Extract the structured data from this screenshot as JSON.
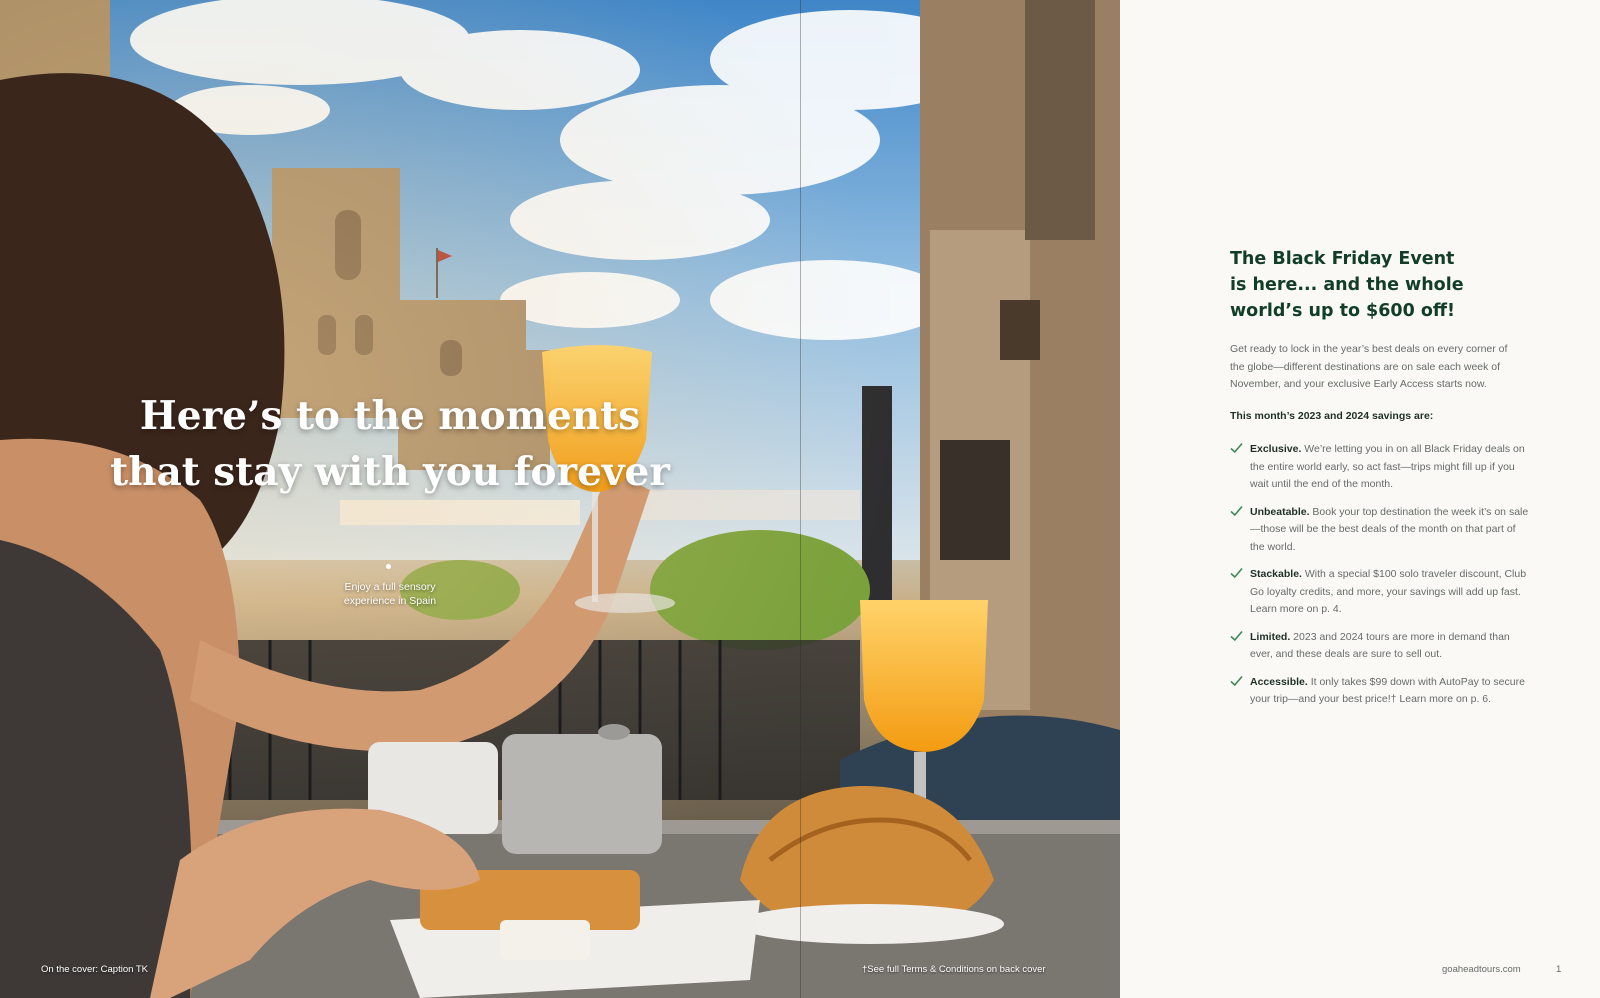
{
  "left_page": {
    "headline": "Here’s to the moments that stay with you forever",
    "photo_caption": "Enjoy a full sensory experience in Spain",
    "cover_caption": "On the cover:  Caption TK",
    "terms_note": "†See full Terms & Conditions on back cover"
  },
  "right_page": {
    "title": "The Black Friday Event is here... and the whole world’s up to $600 off!",
    "intro": "Get ready to lock in the year’s best deals on every corner of the globe—different destinations are on sale each week of November, and your exclusive Early Access starts now.",
    "savings_heading": "This month’s 2023 and 2024 savings are:",
    "benefits": [
      {
        "label": "Exclusive.",
        "text": " We’re letting you in on all Black Friday deals on the entire world early, so act fast—trips might fill up if you wait until the end of the month."
      },
      {
        "label": "Unbeatable.",
        "text": " Book your top destination the week it’s on sale—those will be the best deals of the month on that part of the world."
      },
      {
        "label": "Stackable.",
        "text": " With a special $100 solo traveler discount, Club Go loyalty credits, and more, your savings will add up fast. Learn more on p. 4."
      },
      {
        "label": "Limited.",
        "text": "  2023 and 2024 tours are more in demand than ever, and these deals are sure to sell out."
      },
      {
        "label": "Accessible.",
        "text": " It only takes $99 down with AutoPay to secure your trip—and your best price!† Learn more on p. 6."
      }
    ],
    "site_url": "goaheadtours.com",
    "page_number": "1"
  },
  "colors": {
    "title_green": "#123e28",
    "check_green": "#3c8b5a",
    "body_gray": "#676b67",
    "panel_bg": "#faf9f6"
  },
  "icons": {
    "benefit_bullet": "check-icon"
  }
}
